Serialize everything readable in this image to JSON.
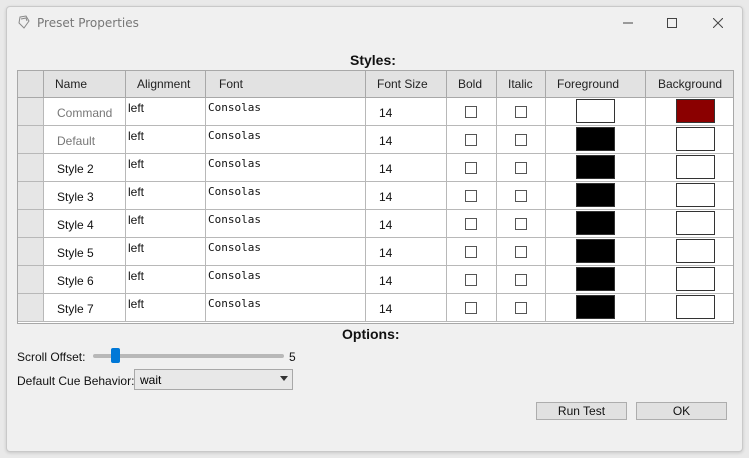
{
  "window": {
    "title": "Preset Properties"
  },
  "styles_section": {
    "title": "Styles:"
  },
  "columns": [
    "Name",
    "Alignment",
    "Font",
    "Font Size",
    "Bold",
    "Italic",
    "Foreground",
    "Background"
  ],
  "rows": [
    {
      "name": "Command",
      "alignment": "left",
      "font": "Consolas",
      "font_size": "14",
      "bold": false,
      "italic": false,
      "foreground": "#ffffff",
      "background": "#8b0000",
      "muted": true
    },
    {
      "name": "Default",
      "alignment": "left",
      "font": "Consolas",
      "font_size": "14",
      "bold": false,
      "italic": false,
      "foreground": "#000000",
      "background": "#ffffff",
      "muted": true
    },
    {
      "name": "Style 2",
      "alignment": "left",
      "font": "Consolas",
      "font_size": "14",
      "bold": false,
      "italic": false,
      "foreground": "#000000",
      "background": "#ffffff",
      "muted": false
    },
    {
      "name": "Style 3",
      "alignment": "left",
      "font": "Consolas",
      "font_size": "14",
      "bold": false,
      "italic": false,
      "foreground": "#000000",
      "background": "#ffffff",
      "muted": false
    },
    {
      "name": "Style 4",
      "alignment": "left",
      "font": "Consolas",
      "font_size": "14",
      "bold": false,
      "italic": false,
      "foreground": "#000000",
      "background": "#ffffff",
      "muted": false
    },
    {
      "name": "Style 5",
      "alignment": "left",
      "font": "Consolas",
      "font_size": "14",
      "bold": false,
      "italic": false,
      "foreground": "#000000",
      "background": "#ffffff",
      "muted": false
    },
    {
      "name": "Style 6",
      "alignment": "left",
      "font": "Consolas",
      "font_size": "14",
      "bold": false,
      "italic": false,
      "foreground": "#000000",
      "background": "#ffffff",
      "muted": false
    },
    {
      "name": "Style 7",
      "alignment": "left",
      "font": "Consolas",
      "font_size": "14",
      "bold": false,
      "italic": false,
      "foreground": "#000000",
      "background": "#ffffff",
      "muted": false
    }
  ],
  "options_section": {
    "title": "Options:",
    "scroll_offset_label": "Scroll Offset:",
    "scroll_offset_value": "5",
    "scroll_offset_fraction": 0.1,
    "cue_behavior_label": "Default Cue Behavior:",
    "cue_behavior_value": "wait"
  },
  "buttons": {
    "run_test": "Run Test",
    "ok": "OK"
  },
  "colors": {
    "accent": "#0078d7",
    "muted_text": "#777777"
  }
}
